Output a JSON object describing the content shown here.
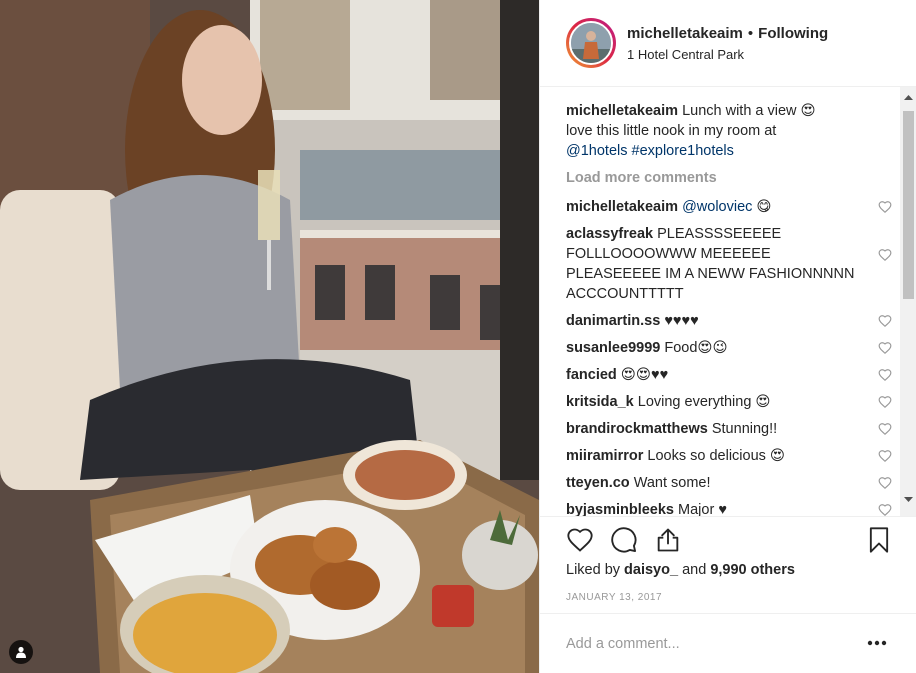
{
  "header": {
    "username": "michelletakeaim",
    "separator": "•",
    "follow_label": "Following",
    "location": "1 Hotel Central Park"
  },
  "caption": {
    "username": "michelletakeaim",
    "text_1": "Lunch with a view 😍",
    "text_2": "love this little nook in my room at",
    "link_1": "@1hotels",
    "link_2": "#explore1hotels"
  },
  "load_more": "Load more comments",
  "comments": [
    {
      "user": "michelletakeaim",
      "mention": "@woloviec",
      "text": " 😋"
    },
    {
      "user": "aclassyfreak",
      "mention": "",
      "text": "PLEASSSSEEEEE FOLLLOOOOWWW MEEEEEE PLEASEEEEE IM A NEWW FASHIONNNNN ACCCOUNTTTTT"
    },
    {
      "user": "danimartin.ss",
      "mention": "",
      "text": "♥♥♥♥"
    },
    {
      "user": "susanlee9999",
      "mention": "",
      "text": "Food😍😉"
    },
    {
      "user": "fancied",
      "mention": "",
      "text": "😍😍♥♥"
    },
    {
      "user": "kritsida_k",
      "mention": "",
      "text": "Loving everything 😍"
    },
    {
      "user": "brandirockmatthews",
      "mention": "",
      "text": "Stunning!!"
    },
    {
      "user": "miiramirror",
      "mention": "",
      "text": "Looks so delicious 😍"
    },
    {
      "user": "tteyen.co",
      "mention": "",
      "text": "Want some!"
    },
    {
      "user": "byjasminbleeks",
      "mention": "",
      "text": "Major ♥"
    }
  ],
  "likes": {
    "prefix": "Liked by",
    "user": "daisyo_",
    "middle": "and",
    "others": "9,990 others"
  },
  "date": "JANUARY 13, 2017",
  "add_comment_placeholder": "Add a comment...",
  "colors": {
    "link": "#003569",
    "muted": "#999999",
    "border": "#efefef"
  }
}
